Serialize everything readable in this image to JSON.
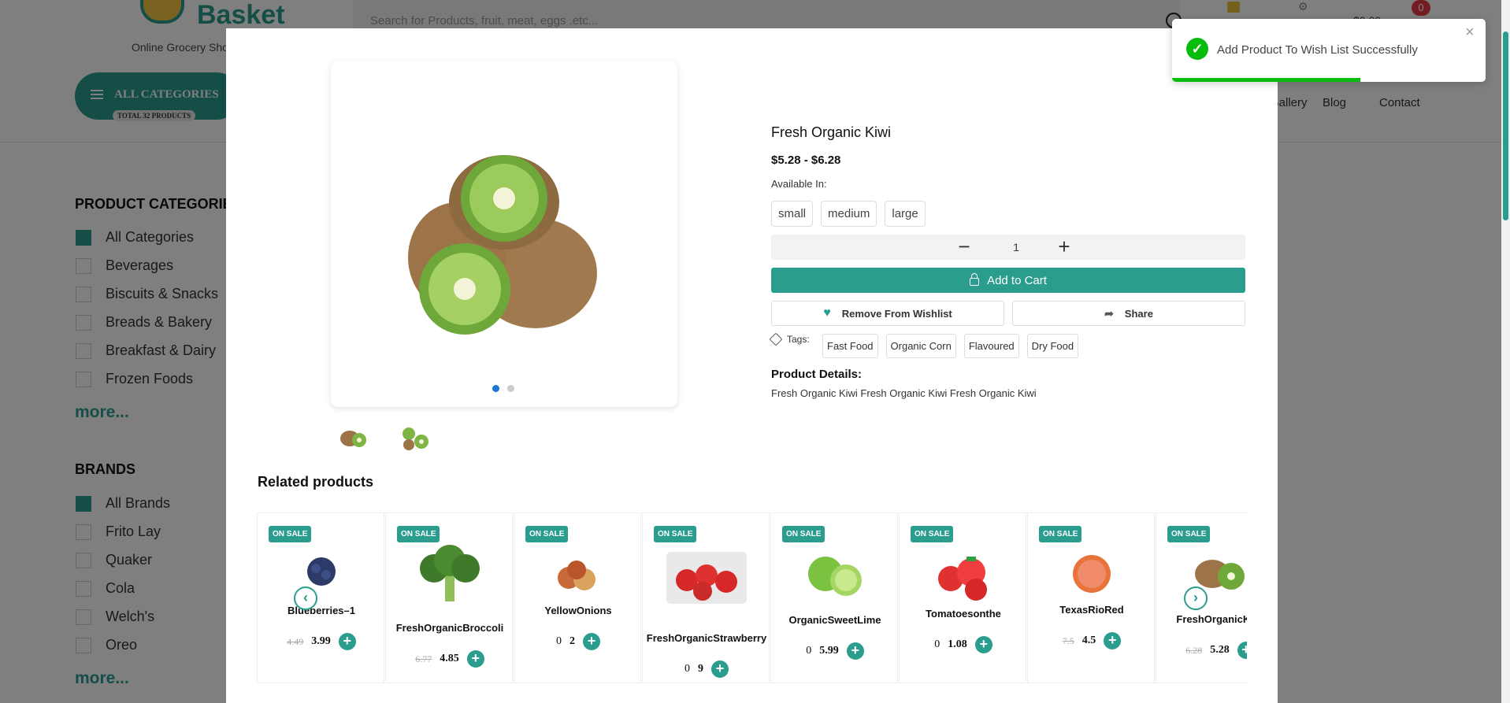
{
  "header": {
    "logo_text": "Basket",
    "logo_sub": "Online Grocery Shop",
    "search_placeholder": "Search for Products, fruit, meat, eggs .etc...",
    "cart_price": "$0.00",
    "cart_count": "0"
  },
  "categories_button": {
    "label": "ALL CATEGORIES",
    "total": "TOTAL 32 PRODUCTS"
  },
  "nav": [
    "Gallery",
    "Blog",
    "Contact"
  ],
  "sidebar": {
    "categories_title": "PRODUCT CATEGORIES",
    "categories": [
      {
        "label": "All Categories",
        "checked": true
      },
      {
        "label": "Beverages",
        "checked": false
      },
      {
        "label": "Biscuits & Snacks",
        "checked": false
      },
      {
        "label": "Breads & Bakery",
        "checked": false
      },
      {
        "label": "Breakfast & Dairy",
        "checked": false
      },
      {
        "label": "Frozen Foods",
        "checked": false
      }
    ],
    "brands_title": "BRANDS",
    "brands": [
      {
        "label": "All Brands",
        "checked": true
      },
      {
        "label": "Frito Lay",
        "checked": false
      },
      {
        "label": "Quaker",
        "checked": false
      },
      {
        "label": "Cola",
        "checked": false
      },
      {
        "label": "Welch's",
        "checked": false
      },
      {
        "label": "Oreo",
        "checked": false
      }
    ],
    "more_label": "more..."
  },
  "product": {
    "title": "Fresh Organic Kiwi",
    "price": "$5.28 - $6.28",
    "available_label": "Available In:",
    "sizes": [
      "small",
      "medium",
      "large"
    ],
    "quantity": "1",
    "add_to_cart": "Add to Cart",
    "wishlist_label": "Remove From Wishlist",
    "share_label": "Share",
    "tags_label": "Tags:",
    "tags": [
      "Fast Food",
      "Organic Corn",
      "Flavoured",
      "Dry Food"
    ],
    "details_title": "Product Details:",
    "details_text": "Fresh Organic Kiwi Fresh Organic Kiwi Fresh Organic Kiwi",
    "image_count": 2,
    "active_image": 1
  },
  "related": {
    "title": "Related products",
    "badge": "ON SALE",
    "items": [
      {
        "name": "Blueberries–1",
        "old": "4.49",
        "new": "3.99",
        "image": "blueberry"
      },
      {
        "name": "FreshOrganicBroccoli",
        "old": "6.77",
        "new": "4.85",
        "image": "broccoli"
      },
      {
        "name": "YellowOnions",
        "old": "0",
        "new": "2",
        "image": "onion"
      },
      {
        "name": "FreshOrganicStrawberry",
        "old": "0",
        "new": "9",
        "image": "strawberry"
      },
      {
        "name": "OrganicSweetLime",
        "old": "0",
        "new": "5.99",
        "image": "lime"
      },
      {
        "name": "Tomatoesonthe",
        "old": "0",
        "new": "1.08",
        "image": "tomato"
      },
      {
        "name": "TexasRioRed",
        "old": "7.5",
        "new": "4.5",
        "image": "grapefruit"
      },
      {
        "name": "FreshOrganicKiwi",
        "old": "6.28",
        "new": "5.28",
        "image": "kiwi"
      }
    ]
  },
  "toast": {
    "message": "Add Product To Wish List Successfully",
    "progress": 0.6
  },
  "colors": {
    "accent": "#2a9d8f",
    "success": "#07bc0c",
    "badge_red": "#e63946"
  }
}
